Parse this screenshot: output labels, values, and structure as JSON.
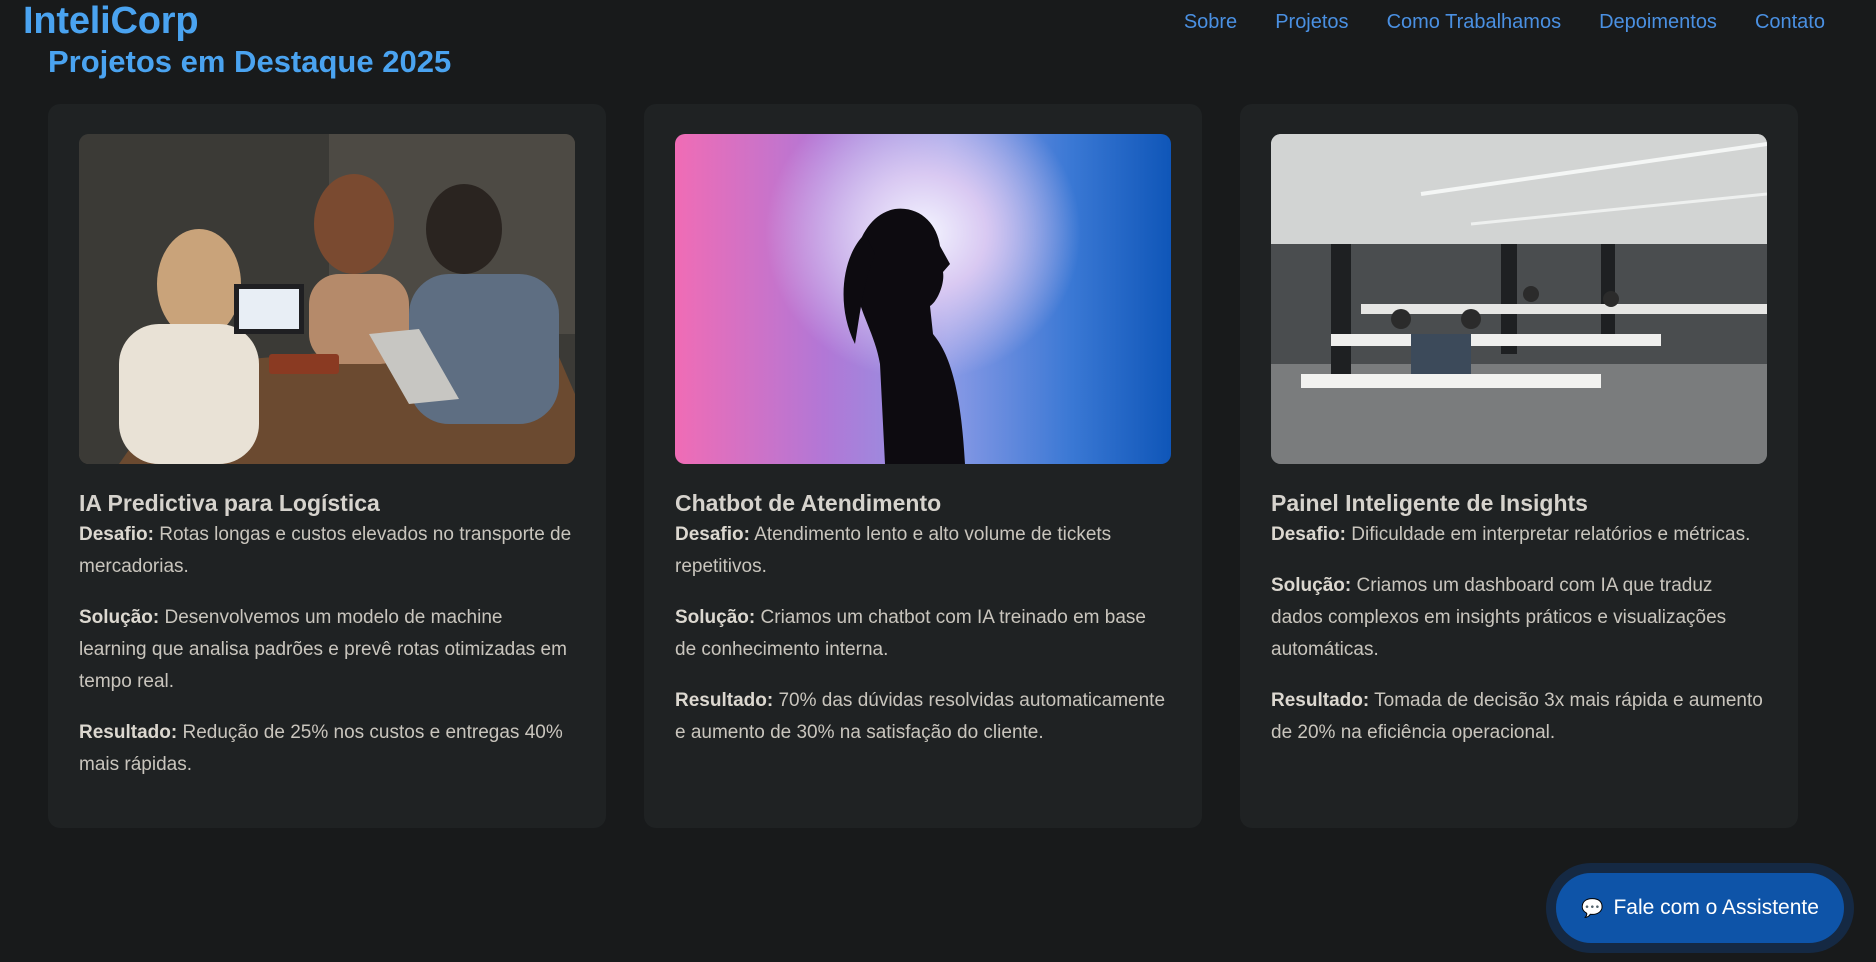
{
  "header": {
    "logo": "InteliCorp",
    "nav": [
      "Sobre",
      "Projetos",
      "Como Trabalhamos",
      "Depoimentos",
      "Contato"
    ]
  },
  "section": {
    "title": "Projetos em Destaque 2025"
  },
  "cards": [
    {
      "title": "IA Predictiva para Logística",
      "image_alt": "team-laptops-photo",
      "desafio_label": "Desafio:",
      "desafio": "Rotas longas e custos elevados no transporte de mercadorias.",
      "solucao_label": "Solução:",
      "solucao": "Desenvolvemos um modelo de machine learning que analisa padrões e prevê rotas otimizadas em tempo real.",
      "resultado_label": "Resultado:",
      "resultado": "Redução de 25% nos custos e entregas 40% mais rápidas."
    },
    {
      "title": "Chatbot de Atendimento",
      "image_alt": "silhouette-gradient-photo",
      "desafio_label": "Desafio:",
      "desafio": "Atendimento lento e alto volume de tickets repetitivos.",
      "solucao_label": "Solução:",
      "solucao": "Criamos um chatbot com IA treinado em base de conhecimento interna.",
      "resultado_label": "Resultado:",
      "resultado": "70% das dúvidas resolvidas automaticamente e aumento de 30% na satisfação do cliente."
    },
    {
      "title": "Painel Inteligente de Insights",
      "image_alt": "open-office-photo",
      "desafio_label": "Desafio:",
      "desafio": "Dificuldade em interpretar relatórios e métricas.",
      "solucao_label": "Solução:",
      "solucao": "Criamos um dashboard com IA que traduz dados complexos em insights práticos e visualizações automáticas.",
      "resultado_label": "Resultado:",
      "resultado": "Tomada de decisão 3x mais rápida e aumento de 20% na eficiência operacional."
    }
  ],
  "assistant": {
    "label": "Fale com o Assistente",
    "icon": "speech-bubble-icon"
  },
  "colors": {
    "accent": "#4aa3f0",
    "nav": "#4a90e2",
    "button": "#0e54a8",
    "bg": "#181a1b",
    "card": "#1f2223"
  }
}
